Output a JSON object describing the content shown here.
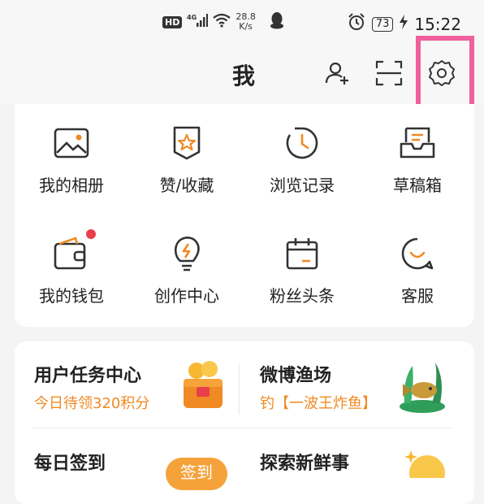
{
  "status": {
    "hd": "HD",
    "speed_value": "28.8",
    "speed_unit": "K/s",
    "battery": "73",
    "time": "15:22"
  },
  "header": {
    "title": "我"
  },
  "grid": [
    {
      "label": "我的相册",
      "icon": "photo-album-icon"
    },
    {
      "label": "赞/收藏",
      "icon": "bookmark-star-icon"
    },
    {
      "label": "浏览记录",
      "icon": "history-clock-icon"
    },
    {
      "label": "草稿箱",
      "icon": "drafts-tray-icon"
    },
    {
      "label": "我的钱包",
      "icon": "wallet-icon"
    },
    {
      "label": "创作中心",
      "icon": "lightbulb-icon"
    },
    {
      "label": "粉丝头条",
      "icon": "calendar-icon"
    },
    {
      "label": "客服",
      "icon": "customer-service-icon"
    }
  ],
  "tasks": {
    "task_center_title": "用户任务中心",
    "task_center_sub": "今日待领320积分",
    "fishing_title": "微博渔场",
    "fishing_sub": "钓【一波王炸鱼】",
    "signin_title": "每日签到",
    "signin_button": "签到",
    "explore_title": "探索新鲜事"
  },
  "colors": {
    "accent": "#f08a24",
    "highlight": "#f0609c",
    "badge": "#e8404a"
  }
}
